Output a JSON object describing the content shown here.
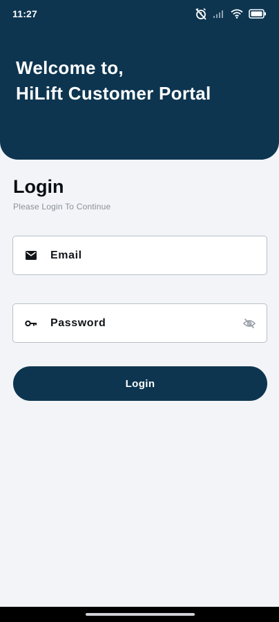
{
  "status_bar": {
    "time": "11:27",
    "icons": [
      "alarm-off-icon",
      "signal-icon",
      "wifi-icon",
      "battery-icon"
    ]
  },
  "header": {
    "line1": "Welcome to,",
    "line2": "HiLift Customer Portal",
    "background_color": "#0d3550"
  },
  "login": {
    "title": "Login",
    "subtitle": "Please Login To Continue",
    "email_label": "Email",
    "email_icon": "mail-icon",
    "password_label": "Password",
    "password_icon": "key-icon",
    "password_toggle_icon": "eye-off-icon",
    "button_label": "Login",
    "button_color": "#0d3550"
  }
}
